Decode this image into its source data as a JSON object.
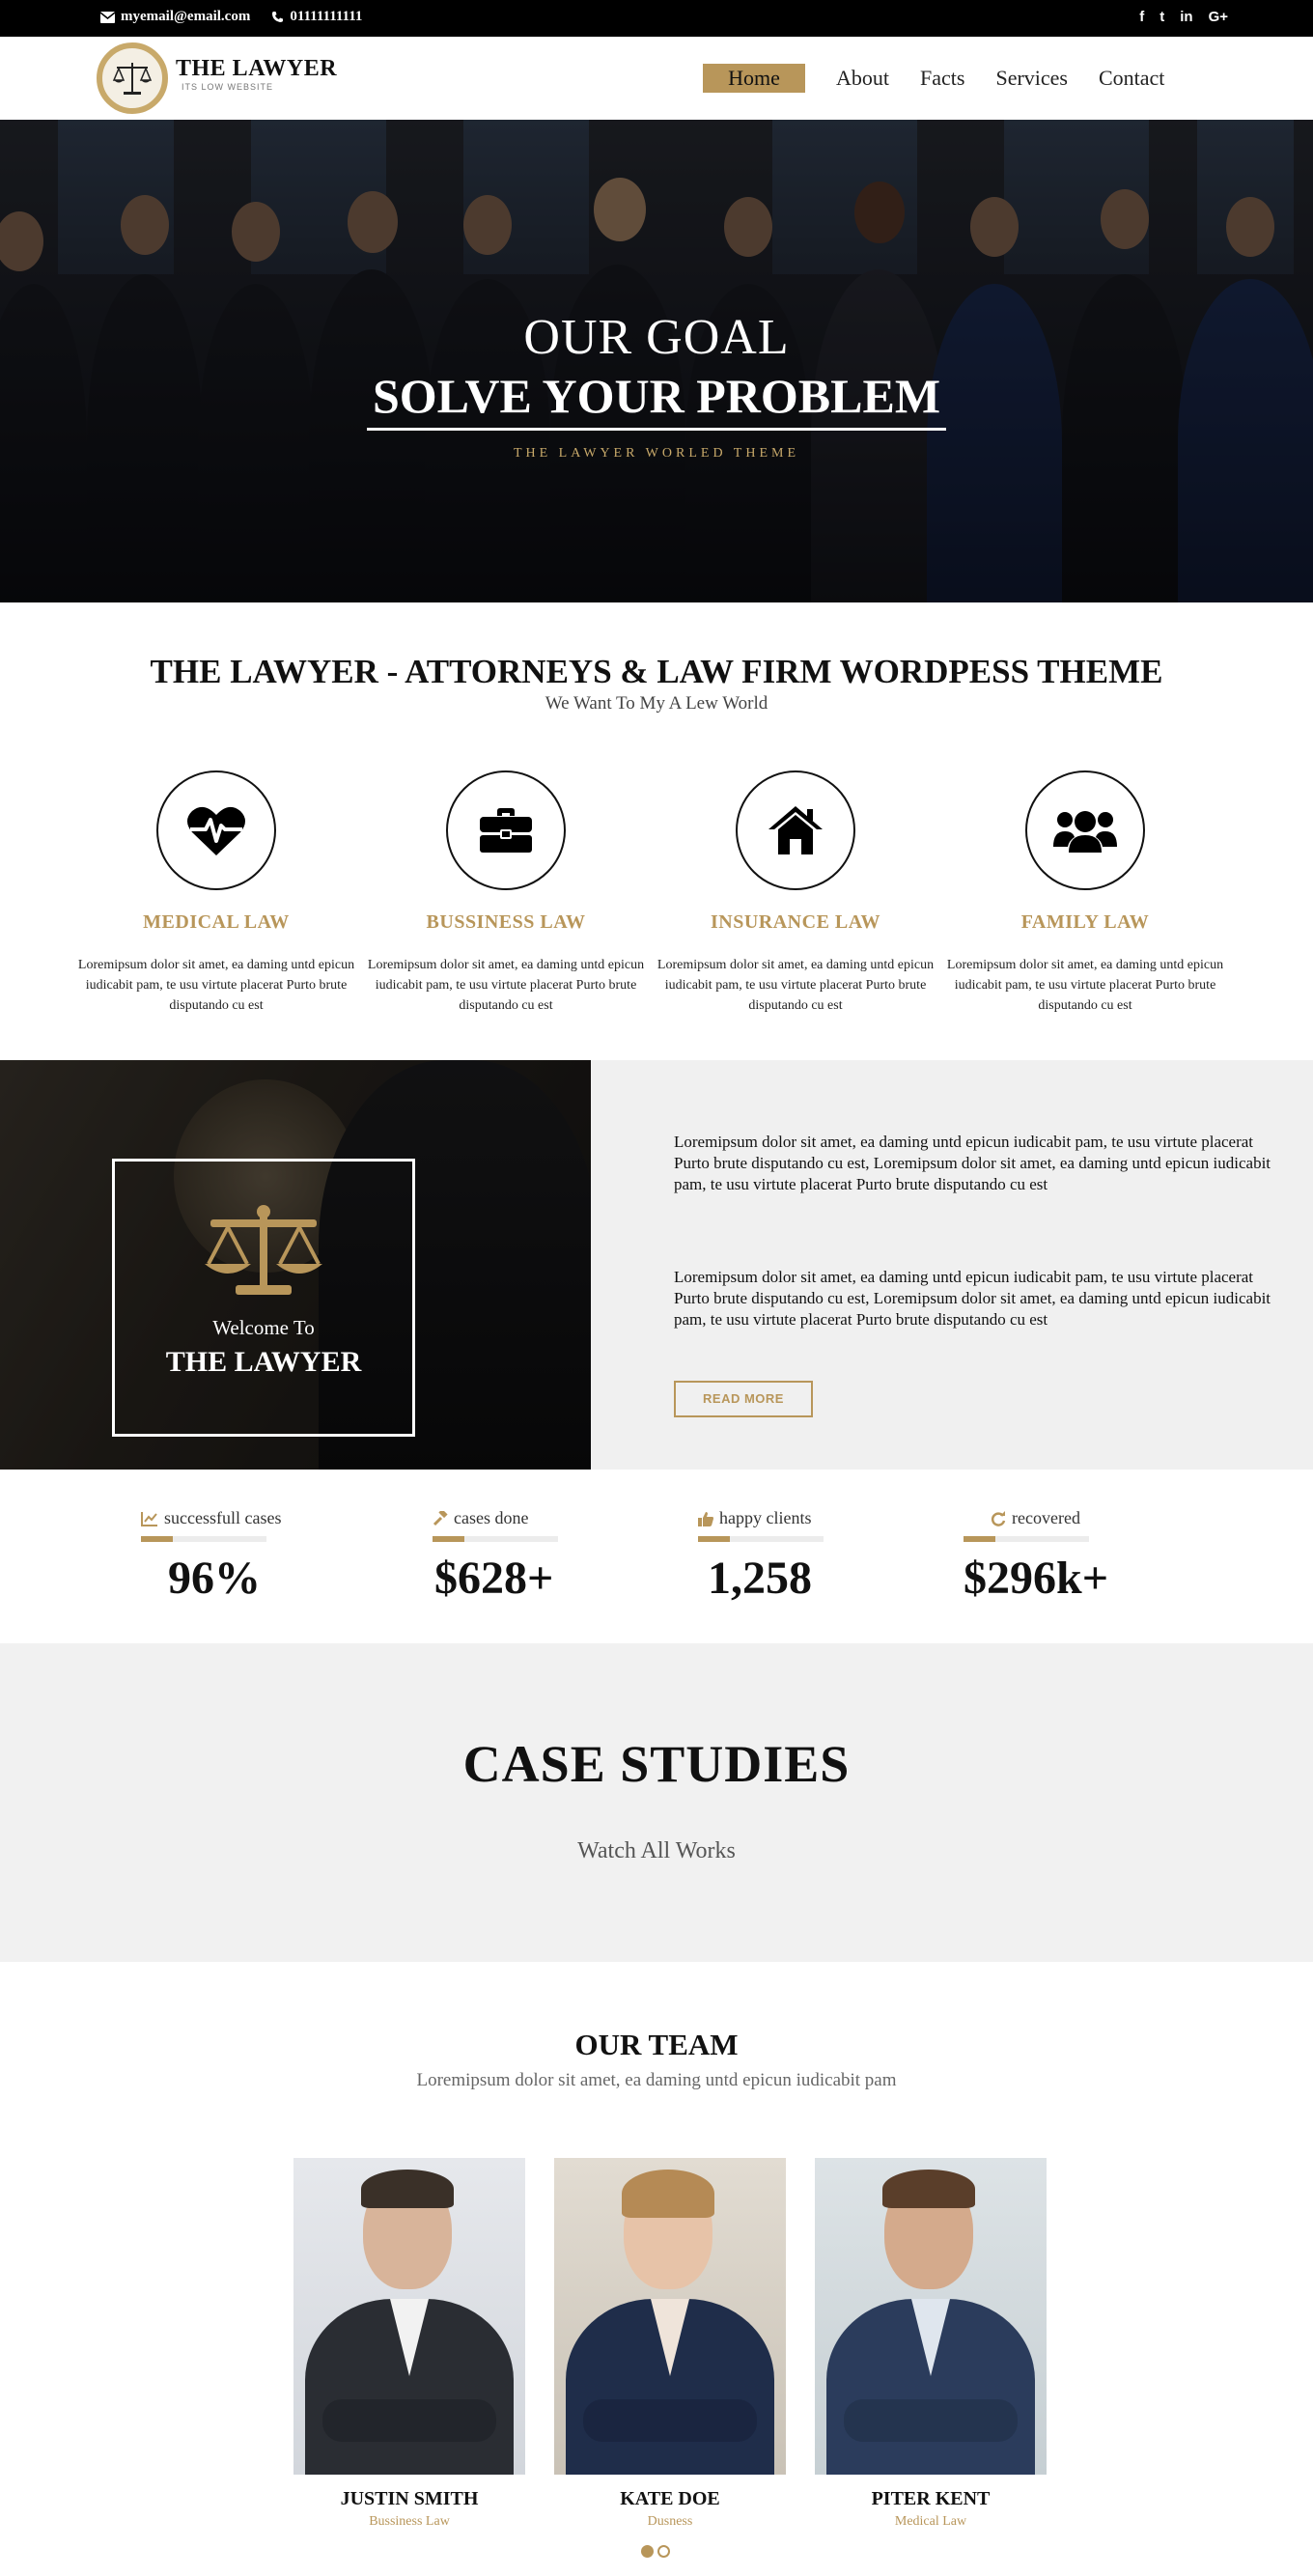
{
  "topbar": {
    "email": "myemail@email.com",
    "phone": "01111111111",
    "social": [
      "f",
      "t",
      "in",
      "G+"
    ]
  },
  "header": {
    "brand_name": "THE LAWYER",
    "brand_tag": "ITS LOW WEBSITE",
    "nav": [
      "Home",
      "About",
      "Facts",
      "Services",
      "Contact"
    ]
  },
  "hero": {
    "line1": "OUR GOAL",
    "line2": "SOLVE YOUR PROBLEM",
    "line3": "THE LAWYER WORLED THEME"
  },
  "intro": {
    "title": "THE LAWYER - ATTORNEYS & LAW FIRM WORDPESS THEME",
    "subtitle": "We Want To My A Lew World"
  },
  "services": [
    {
      "icon": "heartbeat-icon",
      "title": "MEDICAL LAW",
      "text": "Loremipsum dolor sit amet, ea daming untd epicun iudicabit pam, te usu virtute placerat Purto brute disputando cu est"
    },
    {
      "icon": "briefcase-icon",
      "title": "BUSSINESS LAW",
      "text": "Loremipsum dolor sit amet, ea daming untd epicun iudicabit pam, te usu virtute placerat Purto brute disputando cu est"
    },
    {
      "icon": "house-icon",
      "title": "INSURANCE LAW",
      "text": "Loremipsum dolor sit amet, ea daming untd epicun iudicabit pam, te usu virtute placerat Purto brute disputando cu est"
    },
    {
      "icon": "users-icon",
      "title": "FAMILY LAW",
      "text": "Loremipsum dolor sit amet, ea daming untd epicun iudicabit pam, te usu virtute placerat Purto brute disputando cu est"
    }
  ],
  "about": {
    "welcome": "Welcome To",
    "brand": "THE LAWYER",
    "para1": "Loremipsum dolor sit amet, ea daming untd epicun iudicabit pam, te usu virtute placerat Purto brute disputando cu est, Loremipsum dolor sit amet, ea daming untd epicun iudicabit pam, te usu virtute placerat Purto brute disputando cu est",
    "para2": "Loremipsum dolor sit amet, ea daming untd epicun iudicabit pam, te usu virtute placerat Purto brute disputando cu est, Loremipsum dolor sit amet, ea daming untd epicun iudicabit pam, te usu virtute placerat Purto brute disputando cu est",
    "button": "READ MORE"
  },
  "stats": [
    {
      "icon": "chart-icon",
      "label": "successfull cases",
      "value": "96%",
      "progress": 0.25
    },
    {
      "icon": "gavel-icon",
      "label": "cases done",
      "value": "$628+",
      "progress": 0.25
    },
    {
      "icon": "thumbs-up-icon",
      "label": "happy clients",
      "value": "1,258",
      "progress": 0.25
    },
    {
      "icon": "refresh-icon",
      "label": "recovered",
      "value": "$296k+",
      "progress": 0.25
    }
  ],
  "cases": {
    "title": "CASE STUDIES",
    "link": "Watch All Works"
  },
  "team": {
    "title": "OUR TEAM",
    "subtitle": "Loremipsum dolor sit amet, ea daming untd epicun iudicabit pam",
    "members": [
      {
        "name": "JUSTIN SMITH",
        "role": "Bussiness Law"
      },
      {
        "name": "KATE DOE",
        "role": "Dusness"
      },
      {
        "name": "PITER KENT",
        "role": "Medical Law"
      }
    ],
    "slides": 2,
    "active_slide": 0
  },
  "colors": {
    "accent": "#b8965a",
    "topbar": "#000000",
    "light_bg": "#f0f0f0"
  }
}
